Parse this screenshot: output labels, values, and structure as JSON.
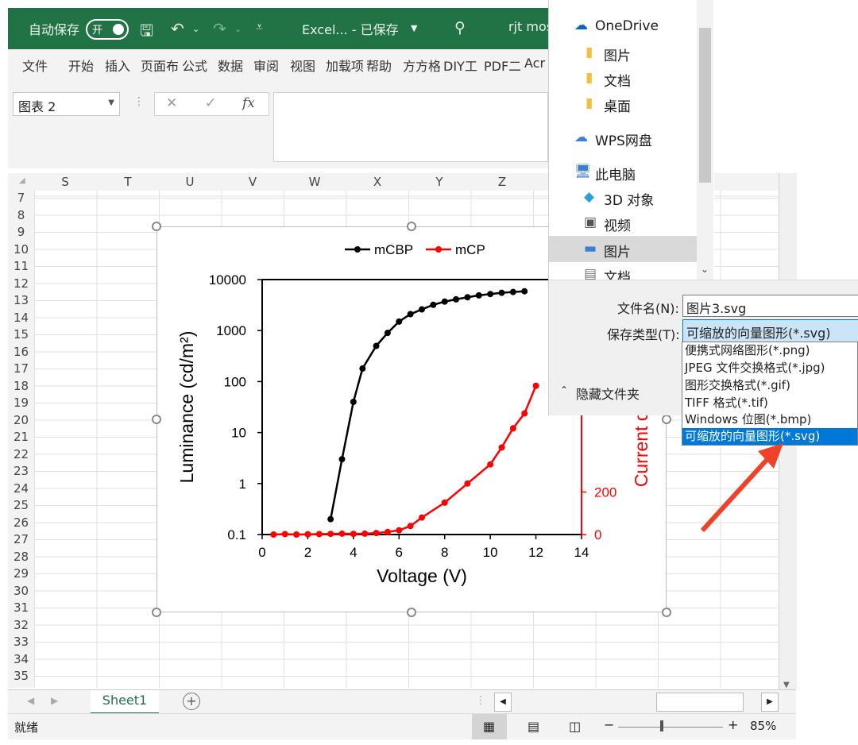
{
  "titlebar": {
    "autosave_label": "自动保存",
    "toggle_label": "开",
    "filename": "Excel... - 已保存",
    "user": "rjt mos"
  },
  "ribbon": {
    "tabs": [
      "文件",
      "开始",
      "插入",
      "页面布",
      "公式",
      "数据",
      "审阅",
      "视图",
      "加载项",
      "帮助",
      "方方格",
      "DIY工",
      "PDF二",
      "Acr"
    ]
  },
  "formula": {
    "namebox": "图表 2",
    "fx": "fx"
  },
  "grid": {
    "columns": [
      "S",
      "T",
      "U",
      "V",
      "W",
      "X",
      "Y",
      "Z"
    ],
    "rows": [
      "7",
      "8",
      "9",
      "10",
      "11",
      "12",
      "13",
      "14",
      "15",
      "16",
      "17",
      "18",
      "19",
      "20",
      "21",
      "22",
      "23",
      "24",
      "25",
      "26",
      "27",
      "28",
      "29",
      "30",
      "31",
      "32",
      "33",
      "34",
      "35"
    ]
  },
  "chart_data": {
    "type": "line",
    "series": [
      {
        "name": "mCBP",
        "color": "#000000",
        "axis": "left",
        "x": [
          3.0,
          3.5,
          4.0,
          4.4,
          5.0,
          5.5,
          6.0,
          6.5,
          7.0,
          7.5,
          8.0,
          8.5,
          9.0,
          9.5,
          10.0,
          10.5,
          11.0,
          11.5
        ],
        "y": [
          0.2,
          3,
          40,
          180,
          500,
          900,
          1500,
          2100,
          2600,
          3200,
          3700,
          4100,
          4500,
          4900,
          5200,
          5500,
          5700,
          5900
        ]
      },
      {
        "name": "mCP",
        "color": "#ff0000",
        "axis": "right",
        "x": [
          0.5,
          1.0,
          1.5,
          2.0,
          2.5,
          3.0,
          3.5,
          4.0,
          4.5,
          5.0,
          5.5,
          6.0,
          6.5,
          7.0,
          8.0,
          9.0,
          10.0,
          10.5,
          11.0,
          11.5,
          12.0
        ],
        "y": [
          0,
          2,
          0,
          1,
          2,
          3,
          4,
          3,
          4,
          7,
          12,
          20,
          40,
          80,
          150,
          240,
          330,
          410,
          500,
          570,
          700
        ]
      }
    ],
    "xlabel": "Voltage (V)",
    "ylabel": "Luminance (cd/m²)",
    "y2label": "Current den",
    "xlim": [
      0,
      14
    ],
    "xticks": [
      "0",
      "2",
      "4",
      "6",
      "8",
      "10",
      "12",
      "14"
    ],
    "ylim": [
      0.1,
      10000
    ],
    "yscale": "log",
    "yticks": [
      "0.1",
      "1",
      "10",
      "100",
      "1000",
      "10000"
    ],
    "y2lim": [
      0,
      1200
    ],
    "y2ticks": [
      "0",
      "200"
    ],
    "legend": "top"
  },
  "dialog": {
    "nav_items": [
      "OneDrive",
      "图片",
      "文档",
      "桌面",
      "WPS网盘",
      "此电脑",
      "3D 对象",
      "视频",
      "图片",
      "文档"
    ],
    "filename_label": "文件名(N):",
    "filename_value": "图片3.svg",
    "filetype_label": "保存类型(T):",
    "filetype_value": "可缩放的向量图形(*.svg)",
    "type_options": [
      "便携式网络图形(*.png)",
      "JPEG 文件交换格式(*.jpg)",
      "图形交换格式(*.gif)",
      "TIFF 格式(*.tif)",
      "Windows 位图(*.bmp)",
      "可缩放的向量图形(*.svg)"
    ],
    "hide_folders": "隐藏文件夹"
  },
  "sheet_tab": "Sheet1",
  "status": {
    "ready": "就绪",
    "zoom": "85%"
  }
}
